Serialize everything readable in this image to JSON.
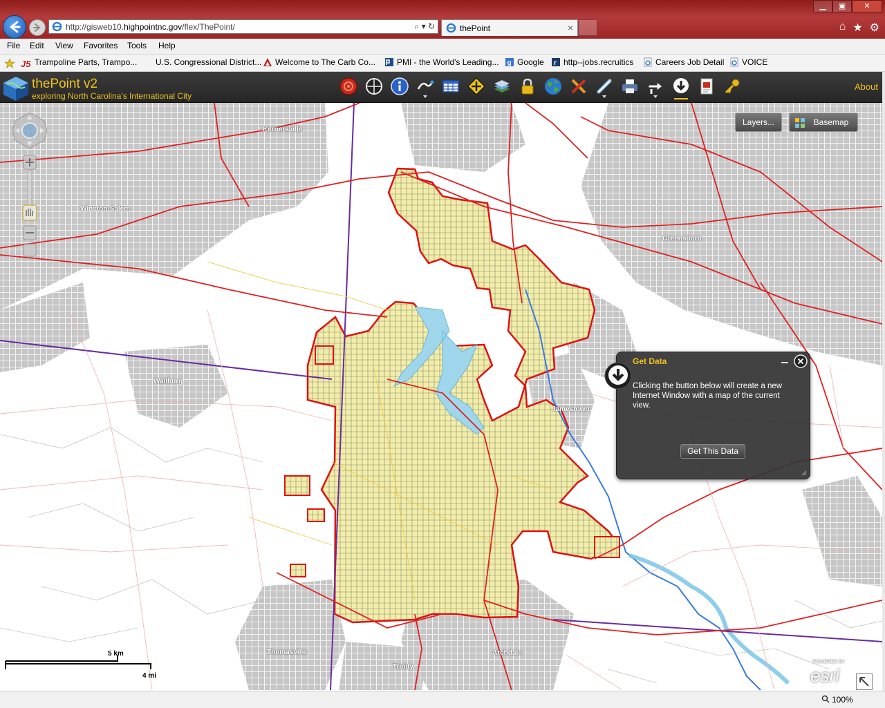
{
  "browser": {
    "url_prefix": "http://gisweb10.",
    "url_domain": "highpointnc.gov",
    "url_path": "/flex/ThePoint/",
    "tab_title": "thePoint",
    "address_controls": "⌕ ▾ ↻",
    "tab_close": "×",
    "window_controls": {
      "minimize": "▁",
      "maximize": "▣",
      "close": "✕"
    },
    "right_tools": {
      "home": "⌂",
      "favorites": "★",
      "settings": "⚙"
    }
  },
  "menu": {
    "file": "File",
    "edit": "Edit",
    "view": "View",
    "favorites": "Favorites",
    "tools": "Tools",
    "help": "Help"
  },
  "favorites_bar": [
    {
      "label": "Trampoline Parts, Trampo...",
      "icon": "js-icon"
    },
    {
      "label": "U.S. Congressional District...",
      "icon": "none"
    },
    {
      "label": "Welcome to The Carb Co...",
      "icon": "triangle-logo-icon"
    },
    {
      "label": "PMI - the World's Leading...",
      "icon": "pmi-icon"
    },
    {
      "label": "Google",
      "icon": "google-icon"
    },
    {
      "label": "http--jobs.recruitics",
      "icon": "r-icon"
    },
    {
      "label": "Careers  Job Detail",
      "icon": "ie-page-icon"
    },
    {
      "label": "VOICE",
      "icon": "ie-page-icon"
    }
  ],
  "app": {
    "title": "thePoint v2",
    "subtitle": "exploring North Carolina's International City",
    "about": "About",
    "tools": [
      "bookmark-icon",
      "crosshair-icon",
      "info-icon",
      "draw-icon",
      "table-icon",
      "navigation-icon",
      "layers-stack-icon",
      "lock-icon",
      "globe-icon",
      "tools-icon",
      "measure-icon",
      "print-icon",
      "pointer-icon",
      "download-icon",
      "report-icon",
      "key-icon"
    ]
  },
  "map": {
    "layers_button": "Layers...",
    "basemap_button": "Basemap",
    "labels": {
      "kernersville": "Kernersville",
      "winston_salem": "Winston-Salem",
      "greensboro": "Greensboro",
      "wallburg": "Wallburg",
      "jamestown": "Jamestown",
      "thomasville": "Thomasville",
      "archdale": "Archdale",
      "trinity": "Trinity"
    },
    "scale_km": "5 km",
    "scale_mi": "4 mi",
    "esri_powered": "POWERED BY",
    "esri": "esri",
    "colors": {
      "city_fill": "#f2eeaa",
      "city_border": "#e01010",
      "lake": "#9fd6ec",
      "urban_gray": "#c8c8c8",
      "highway": "#e02020",
      "county_line": "#6a2aa0"
    }
  },
  "panel": {
    "title": "Get Data",
    "body": "Clicking the button below will create a new Internet Window with a map of the current view.",
    "button": "Get This Data"
  },
  "status": {
    "zoom": "100%"
  }
}
